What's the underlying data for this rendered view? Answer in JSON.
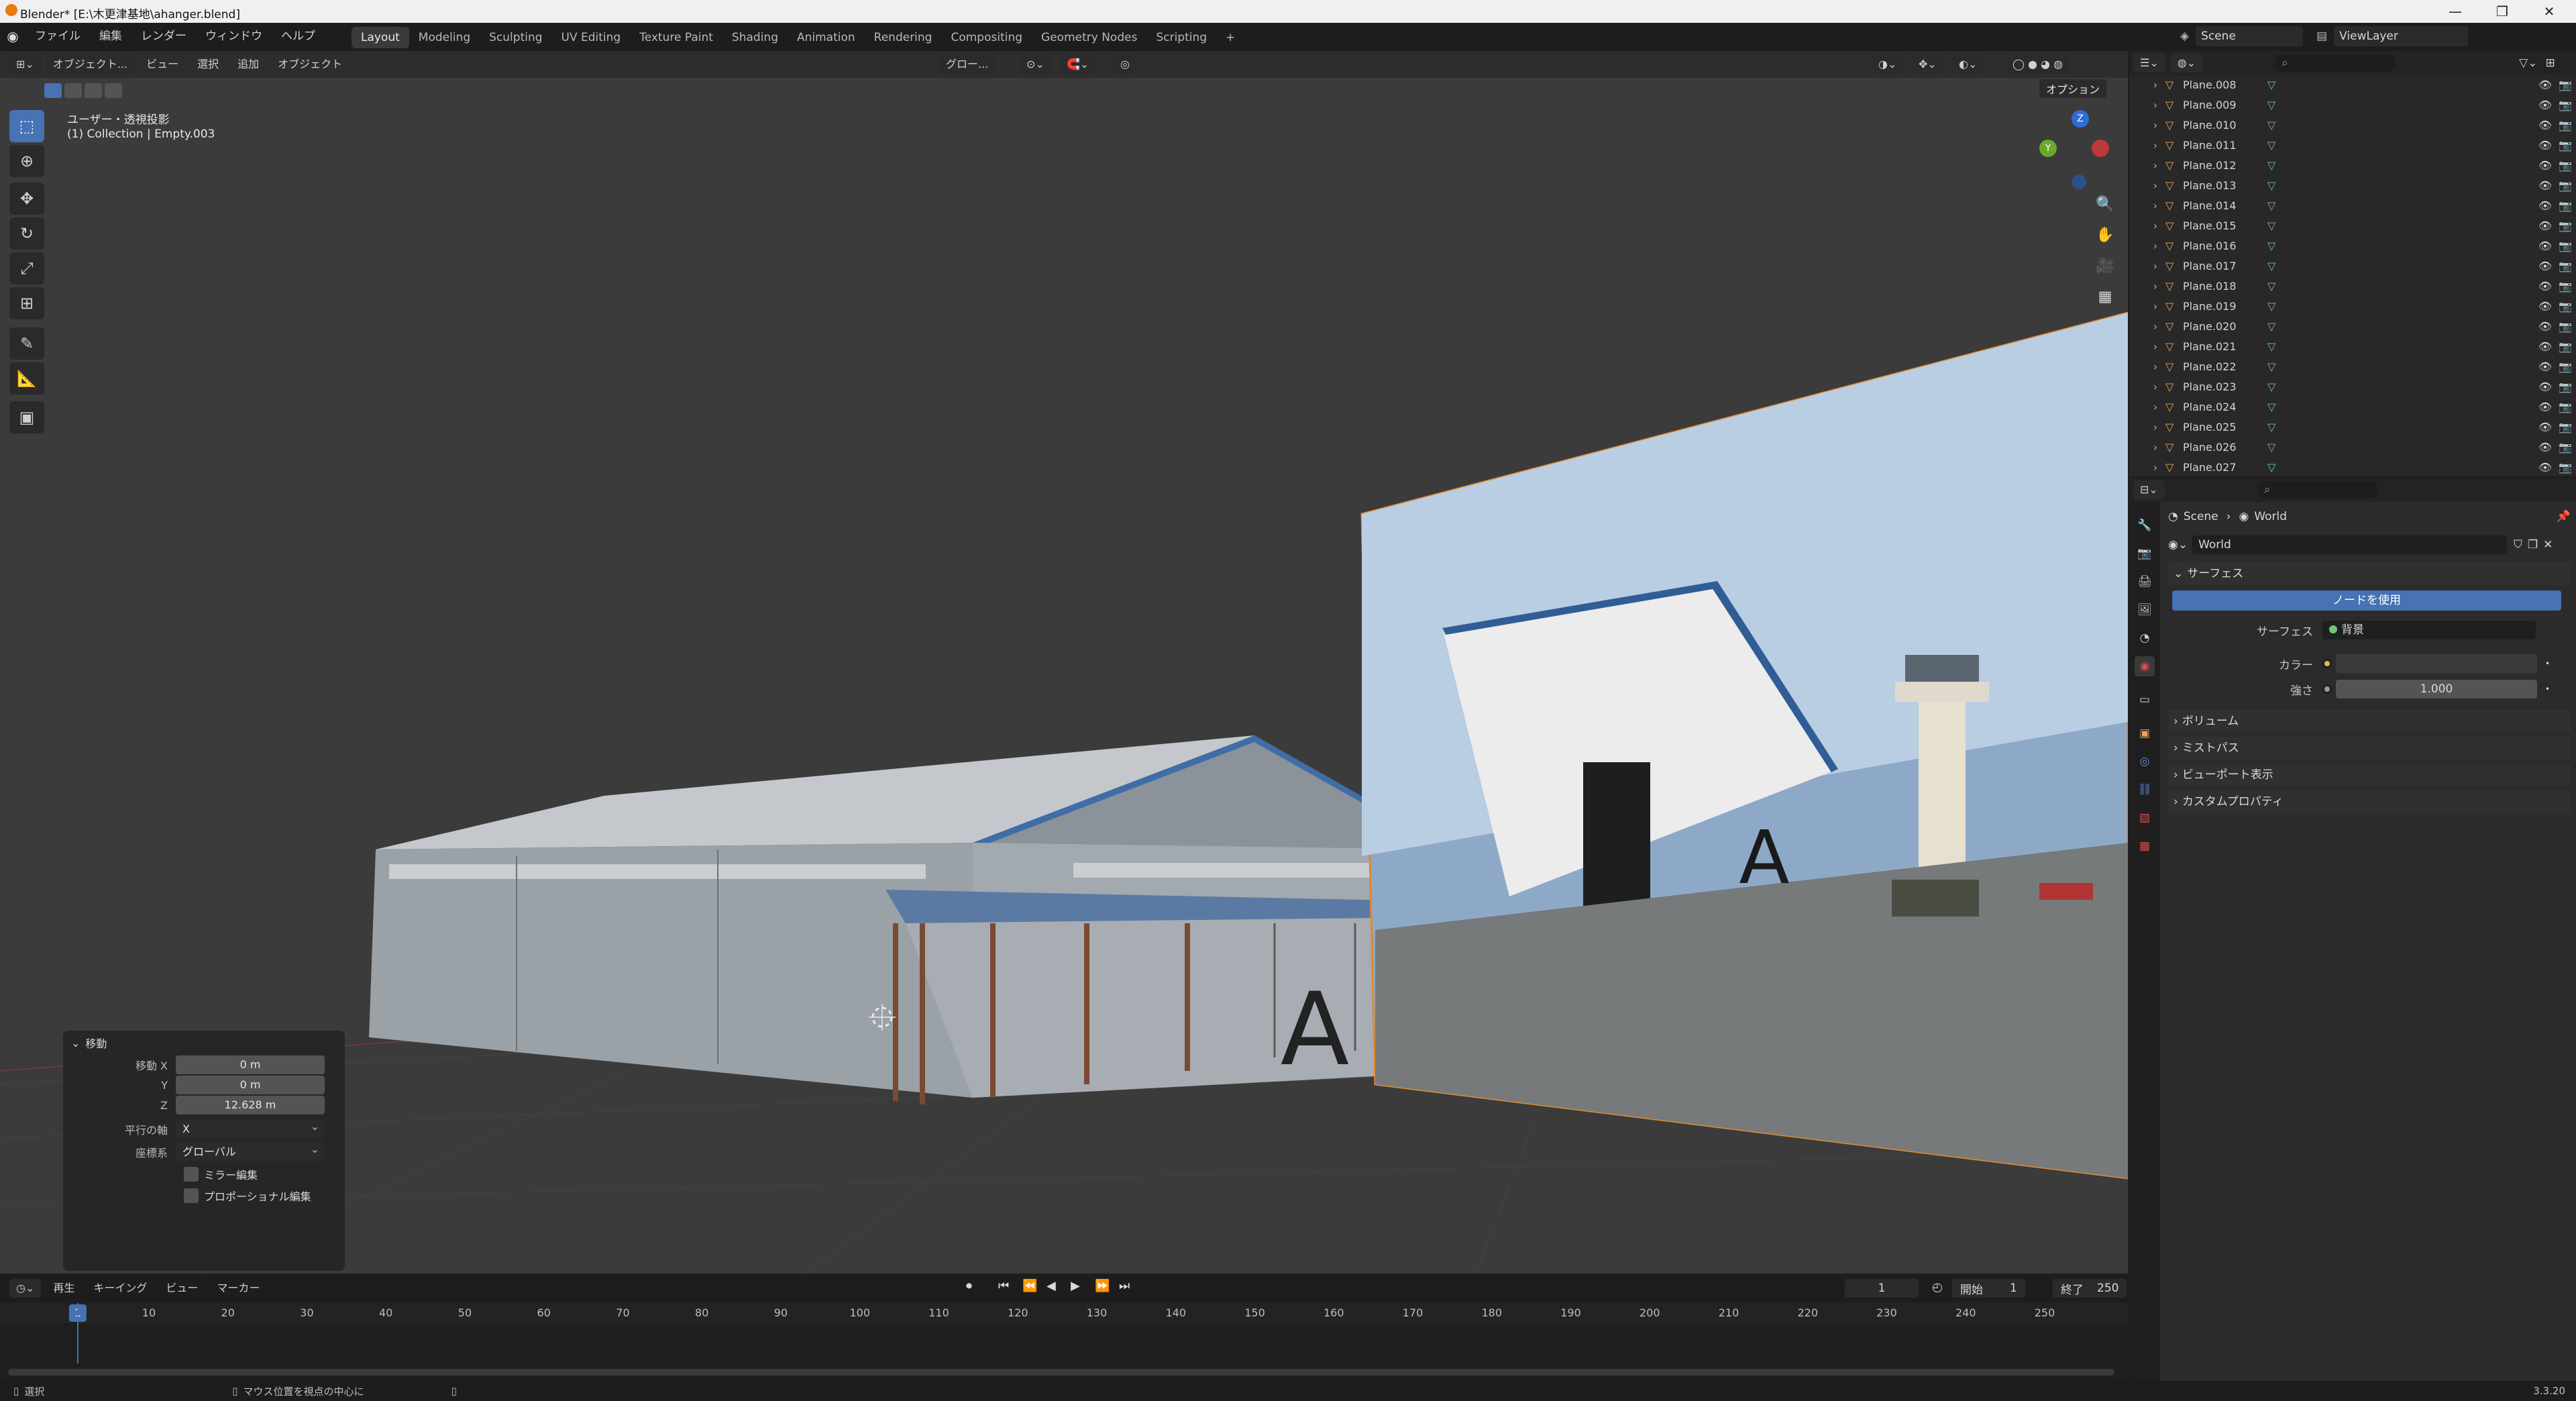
{
  "window": {
    "title": "Blender* [E:\\木更津基地\\ahanger.blend]",
    "controls": {
      "minimize": "—",
      "maximize": "❐",
      "close": "✕"
    }
  },
  "menus": [
    "ファイル",
    "編集",
    "レンダー",
    "ウィンドウ",
    "ヘルプ"
  ],
  "workspaces": [
    "Layout",
    "Modeling",
    "Sculpting",
    "UV Editing",
    "Texture Paint",
    "Shading",
    "Animation",
    "Rendering",
    "Compositing",
    "Geometry Nodes",
    "Scripting"
  ],
  "active_workspace": "Layout",
  "add_workspace_symbol": "+",
  "scene_selector": {
    "scene": "Scene",
    "view_layer": "ViewLayer"
  },
  "viewport": {
    "mode": "オブジェクト...",
    "menus": [
      "ビュー",
      "選択",
      "追加",
      "オブジェクト"
    ],
    "transform_orientation": "グロー...",
    "options": "オプション",
    "view_name": "ユーザー・透視投影",
    "collection_info": "(1) Collection | Empty.003",
    "gizmo": {
      "z": "Z",
      "y": "Y"
    }
  },
  "tools": [
    "select-icon",
    "cursor-icon",
    "move-icon",
    "rotate-icon",
    "scale-icon",
    "transform-icon",
    "annotate-icon",
    "measure-icon",
    "add-cube-icon"
  ],
  "operator_panel": {
    "title": "移動",
    "move_x_label": "移動 X",
    "move_x": "0 m",
    "move_y_label": "Y",
    "move_y": "0 m",
    "move_z_label": "Z",
    "move_z": "12.628 m",
    "axis_label": "平行の軸",
    "axis": "X",
    "coord_label": "座標系",
    "coord": "グローバル",
    "mirror_label": "ミラー編集",
    "proportional_label": "プロポーショナル編集"
  },
  "hangar_sign": "A",
  "timeline": {
    "menus": [
      "再生",
      "キーイング",
      "ビュー",
      "マーカー"
    ],
    "current_frame": "1",
    "start_label": "開始",
    "start": "1",
    "end_label": "終了",
    "end": "250",
    "ticks": [
      "1",
      "10",
      "20",
      "30",
      "40",
      "50",
      "60",
      "70",
      "80",
      "90",
      "100",
      "110",
      "120",
      "130",
      "140",
      "150",
      "160",
      "170",
      "180",
      "190",
      "200",
      "210",
      "220",
      "230",
      "240",
      "250"
    ]
  },
  "status": {
    "left": "選択",
    "middle": "マウス位置を視点の中心に",
    "version": "3.3.20"
  },
  "outliner": {
    "items": [
      "Plane.008",
      "Plane.009",
      "Plane.010",
      "Plane.011",
      "Plane.012",
      "Plane.013",
      "Plane.014",
      "Plane.015",
      "Plane.016",
      "Plane.017",
      "Plane.018",
      "Plane.019",
      "Plane.020",
      "Plane.021",
      "Plane.022",
      "Plane.023",
      "Plane.024",
      "Plane.025",
      "Plane.026",
      "Plane.027"
    ]
  },
  "properties": {
    "breadcrumb_scene": "Scene",
    "breadcrumb_world": "World",
    "world_name": "World",
    "surface_section": "サーフェス",
    "use_nodes_button": "ノードを使用",
    "surface_label": "サーフェス",
    "surface_value": "背景",
    "color_label": "カラー",
    "strength_label": "強さ",
    "strength_value": "1.000",
    "collapsed_sections": [
      "ボリューム",
      "ミストパス",
      "ビューポート表示",
      "カスタムプロパティ"
    ]
  },
  "colors": {
    "accent": "#4772b3",
    "viewport_bg": "#3b3b3b",
    "mesh_icon": "#e8a25a",
    "data_icon": "#6fc97a"
  }
}
